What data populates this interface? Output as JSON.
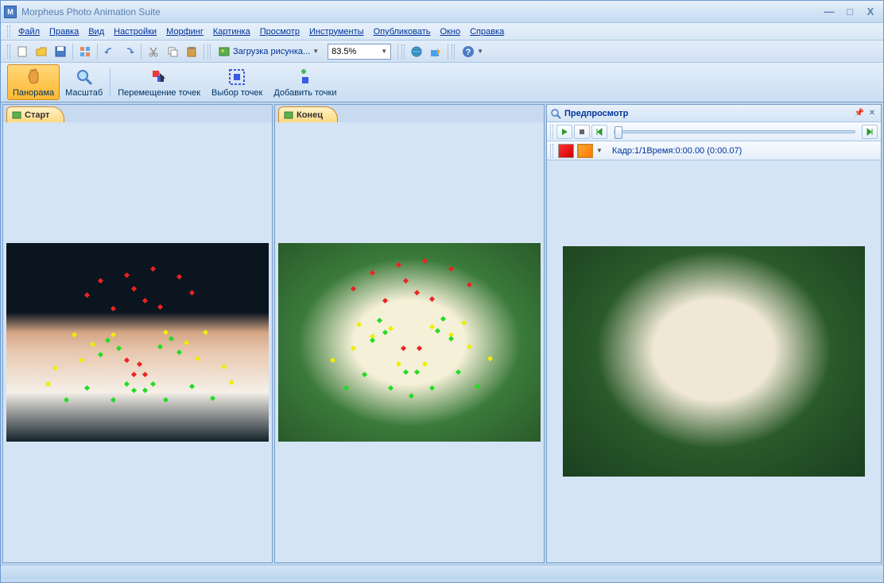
{
  "title": "Morpheus Photo Animation Suite",
  "menus": [
    "Файл",
    "Правка",
    "Вид",
    "Настройки",
    "Морфинг",
    "Картинка",
    "Просмотр",
    "Инструменты",
    "Опубликовать",
    "Окно",
    "Справка"
  ],
  "toolbar": {
    "load_image": "Загрузка рисунка...",
    "zoom_value": "83.5%"
  },
  "tools": {
    "panorama": "Панорама",
    "scale": "Масштаб",
    "move_points": "Перемещение точек",
    "select_points": "Выбор точек",
    "add_points": "Добавить точки"
  },
  "tabs": {
    "start": "Старт",
    "end": "Конец"
  },
  "preview": {
    "title": "Предпросмотр",
    "frame_info": "Кадр:1/1Время:0:00.00 (0:00.07)"
  }
}
